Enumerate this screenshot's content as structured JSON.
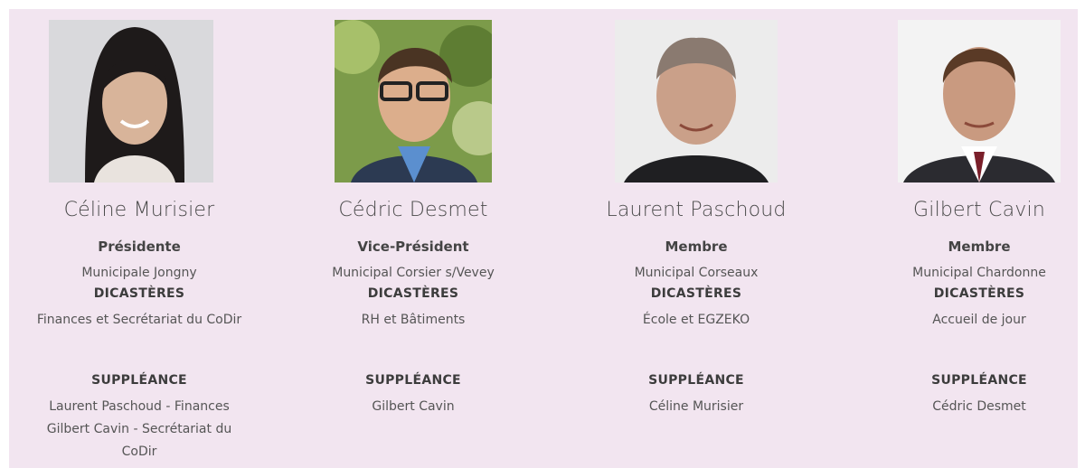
{
  "theme": {
    "panel_bg": "#f2e5f0",
    "text": "#3f3f3f"
  },
  "members": [
    {
      "photo_icon": "portrait-photo",
      "name": "Céline Murisier",
      "role": "Présidente",
      "municipality": "Municipale Jongny",
      "dicasteres_label": "DICASTÈRES",
      "dicasteres": "Finances et Secrétariat du CoDir",
      "suppleance_label": "SUPPLÉANCE",
      "suppleance": [
        "Laurent Paschoud - Finances",
        "Gilbert Cavin - Secrétariat du",
        "CoDir"
      ]
    },
    {
      "photo_icon": "portrait-photo",
      "name": "Cédric Desmet",
      "role": "Vice-Président",
      "municipality": "Municipal Corsier s/Vevey",
      "dicasteres_label": "DICASTÈRES",
      "dicasteres": "RH et Bâtiments",
      "suppleance_label": "SUPPLÉANCE",
      "suppleance": [
        "Gilbert Cavin"
      ]
    },
    {
      "photo_icon": "portrait-photo",
      "name": "Laurent Paschoud",
      "role": "Membre",
      "municipality": "Municipal Corseaux",
      "dicasteres_label": "DICASTÈRES",
      "dicasteres": "École et EGZEKO",
      "suppleance_label": "SUPPLÉANCE",
      "suppleance": [
        "Céline Murisier"
      ]
    },
    {
      "photo_icon": "portrait-photo",
      "name": "Gilbert Cavin",
      "role": "Membre",
      "municipality": "Municipal Chardonne",
      "dicasteres_label": "DICASTÈRES",
      "dicasteres": "Accueil de jour",
      "suppleance_label": "SUPPLÉANCE",
      "suppleance": [
        "Cédric Desmet"
      ]
    }
  ]
}
